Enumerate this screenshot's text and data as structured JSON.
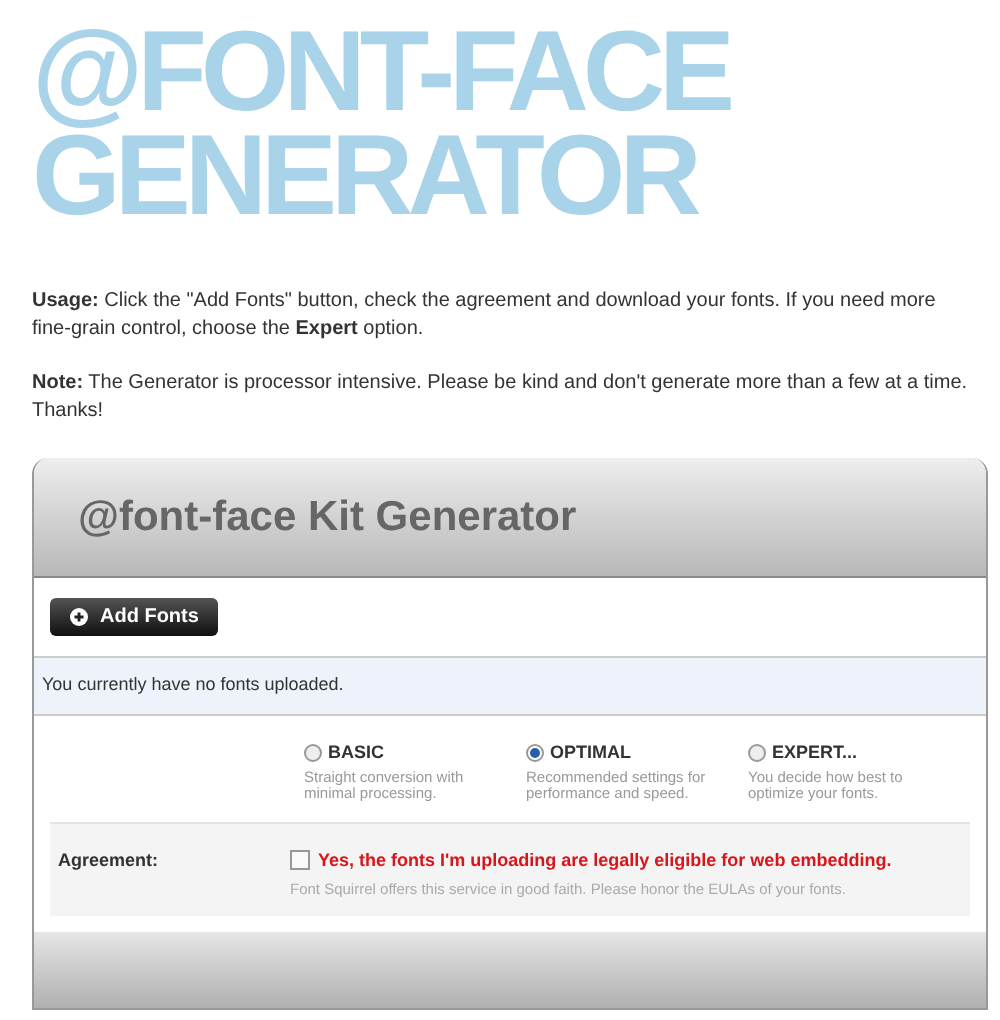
{
  "hero_title": [
    "@FONT-FACE",
    "GENERATOR"
  ],
  "paragraphs": [
    "**Usage:** Click the \"Add Fonts\" button, check the agreement and download your fonts. If you need more fine-grain control, choose the **Expert** option.",
    "**Note:** The Generator is processor intensive. Please be kind and don't generate more than a few at a time. Thanks!"
  ],
  "panel": {
    "title": "@font-face Kit Generator",
    "add_button": {
      "label": "Add Fonts"
    },
    "status": "You currently have no fonts uploaded.",
    "modes": [
      {
        "label": "BASIC",
        "description": "Straight conversion with minimal processing.",
        "selected": false
      },
      {
        "label": "OPTIMAL",
        "description": "Recommended settings for performance and speed.",
        "selected": true
      },
      {
        "label": "EXPERT...",
        "description": "You decide how best to optimize your fonts.",
        "selected": false
      }
    ],
    "agreement": {
      "label": "Agreement:",
      "checkbox_label": "Yes, the fonts I'm uploading are legally eligible for web embedding.",
      "checked": false,
      "note": "Font Squirrel offers this service in good faith. Please honor the EULAs of your fonts."
    }
  }
}
